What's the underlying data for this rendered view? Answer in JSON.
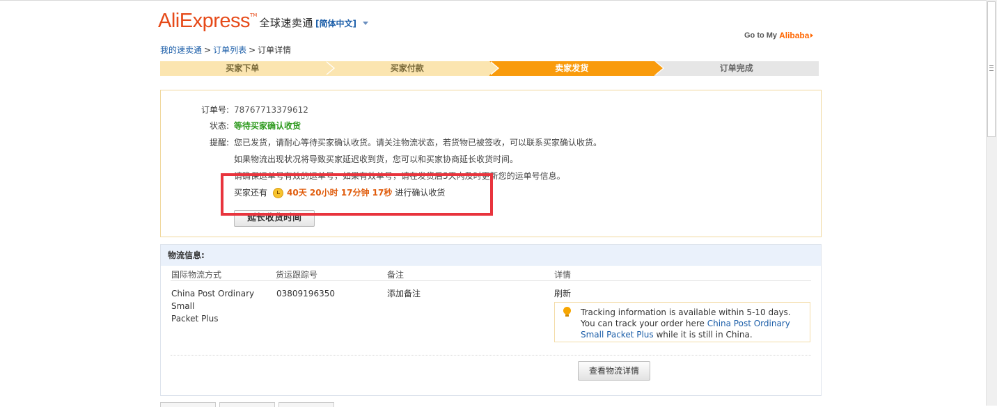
{
  "header": {
    "logo_text": "AliExpress",
    "logo_tm": "TM",
    "logo_cn": "全球速卖通",
    "language": "[简体中文]",
    "goto_label": "Go to My",
    "goto_brand": "Alibaba"
  },
  "breadcrumb": {
    "home": "我的速卖通",
    "list": "订单列表",
    "current": "订单详情",
    "sep": ">"
  },
  "steps": [
    "买家下单",
    "买家付款",
    "卖家发货",
    "订单完成"
  ],
  "active_step": 2,
  "order": {
    "order_no_label": "订单号:",
    "order_no": "78767713379612",
    "status_label": "状态:",
    "status": "等待买家确认收货",
    "tip_label": "提醒:",
    "tip_lines": [
      "您已发货，请耐心等待买家确认收货。请关注物流状态，若货物已被签收，可以联系买家确认收货。",
      "如果物流出现状况将导致买家延迟收到货，您可以和买家协商延长收货时间。",
      "请确保运单号有效的运单号，如果有效单号，请在发货后5天内及时更新您的运单号信息。"
    ],
    "countdown_prefix": "买家还有",
    "countdown": "40天 20小时 17分钟 17秒",
    "countdown_suffix": "进行确认收货",
    "extend_button": "延长收货时间"
  },
  "logistics": {
    "title": "物流信息:",
    "columns": [
      "国际物流方式",
      "货运跟踪号",
      "备注",
      "详情"
    ],
    "method_line1": "China Post Ordinary Small",
    "method_line2": "Packet Plus",
    "tracking_no": "03809196350",
    "add_note": "添加备注",
    "refresh": "刷新",
    "track_info_pre": "Tracking information is available within 5-10 days. You can track your order here",
    "track_info_link": "China Post Ordinary Small Packet Plus",
    "track_info_post": "while it is still in China.",
    "detail_button": "查看物流详情"
  },
  "colors": {
    "brand": "#e64a19",
    "active_step": "#f99b0c",
    "status_green": "#2e9a1e",
    "countdown": "#e05c0c",
    "highlight": "#e8343d"
  }
}
